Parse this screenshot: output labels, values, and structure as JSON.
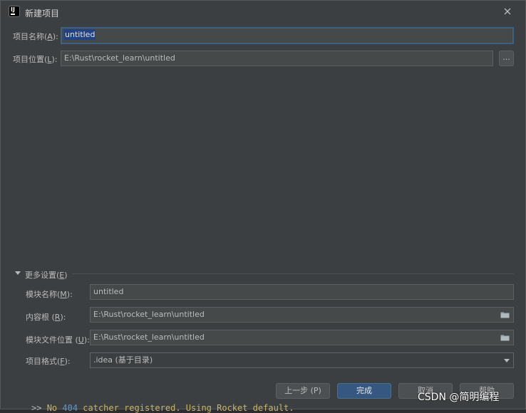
{
  "dialog": {
    "title": "新建项目"
  },
  "project": {
    "name_label_pre": "项目名称(",
    "name_label_key": "A",
    "name_label_post": "):",
    "name_value": "untitled",
    "location_label_pre": "项目位置(",
    "location_label_key": "L",
    "location_label_post": "):",
    "location_value": "E:\\Rust\\rocket_learn\\untitled",
    "browse_label": "..."
  },
  "more_settings": {
    "label_pre": "更多设置(",
    "label_key": "E",
    "label_post": ")",
    "module_name_label_pre": "模块名称(",
    "module_name_label_key": "M",
    "module_name_label_post": "):",
    "module_name_value": "untitled",
    "content_root_label_pre": "内容根 (",
    "content_root_label_key": "R",
    "content_root_label_post": "):",
    "content_root_value": "E:\\Rust\\rocket_learn\\untitled",
    "module_file_label_pre": "模块文件位置 (",
    "module_file_label_key": "U",
    "module_file_label_post": "):",
    "module_file_value": "E:\\Rust\\rocket_learn\\untitled",
    "format_label_pre": "项目格式(",
    "format_label_key": "F",
    "format_label_post": "):",
    "format_value": ".idea (基于目录)"
  },
  "footer": {
    "prev_label": "上一步 (P)",
    "finish_label": "完成",
    "cancel_label": "取消",
    "help_label": "帮助"
  },
  "background": {
    "console_prefix": ">> ",
    "console_text_a": "No ",
    "console_code": "404",
    "console_text_b": " catcher registered. Using Rocket default."
  },
  "watermark": "CSDN @简明编程",
  "colors": {
    "dialog_bg": "#3c3f41",
    "field_bg": "#45494a",
    "focus_border": "#3d6185",
    "primary_button": "#365880",
    "text": "#bbbbbb"
  },
  "icons": {
    "app": "intellij-icon",
    "close": "close-icon",
    "folder": "folder-icon",
    "dropdown": "chevron-down-icon",
    "expand": "triangle-down-icon"
  }
}
